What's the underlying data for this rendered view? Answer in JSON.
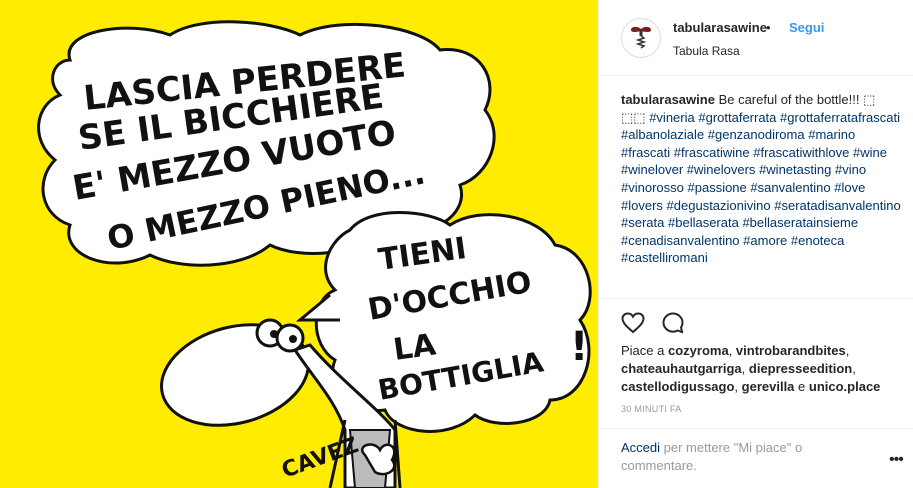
{
  "post": {
    "speech_top_lines": [
      "LASCIA PERDERE",
      "SE IL BICCHIERE",
      "E' MEZZO VUOTO",
      "O MEZZO PIENO..."
    ],
    "speech_bottom_lines": [
      "TIENI",
      "D'OCCHIO",
      "LA",
      "BOTTIGLIA",
      "!"
    ],
    "signature": "CAVEZ",
    "background_color": "#ffec00"
  },
  "header": {
    "username": "tabularasawine",
    "separator": "•",
    "follow_label": "Segui",
    "location": "Tabula Rasa",
    "avatar_icon": "corkscrew-icon"
  },
  "caption": {
    "username": "tabularasawine",
    "text": "Be careful of the bottle!!! ",
    "trailing_glyphs": "⬚ ⬚⬚",
    "hashtags": [
      "#vineria",
      "#grottaferrata",
      "#grottaferratafrascati",
      "#albanolaziale",
      "#genzanodiroma",
      "#marino",
      "#frascati",
      "#frascatiwine",
      "#frascatiwithlove",
      "#wine",
      "#winelover",
      "#winelovers",
      "#winetasting",
      "#vino",
      "#vinorosso",
      "#passione",
      "#sanvalentino",
      "#love",
      "#lovers",
      "#degustazionivino",
      "#seratadisanvalentino",
      "#serata",
      "#bellaserata",
      "#bellaseratainsieme",
      "#cenadisanvalentino",
      "#amore",
      "#enoteca",
      "#castelliromani"
    ]
  },
  "actions": {
    "like_icon": "heart-icon",
    "comment_icon": "comment-icon"
  },
  "likes": {
    "prefix": "Piace a ",
    "names": [
      "cozyroma",
      "vintrobarandbites",
      "chateauhautgarriga",
      "diepresseedition",
      "castellodigussago",
      "gerevilla"
    ],
    "conjunction": " e ",
    "last_name": "unico.place"
  },
  "time": "30 MINUTI FA",
  "comment": {
    "login_link": "Accedi",
    "login_text": " per mettere \"Mi piace\" o commentare.",
    "more_label": "•••"
  }
}
